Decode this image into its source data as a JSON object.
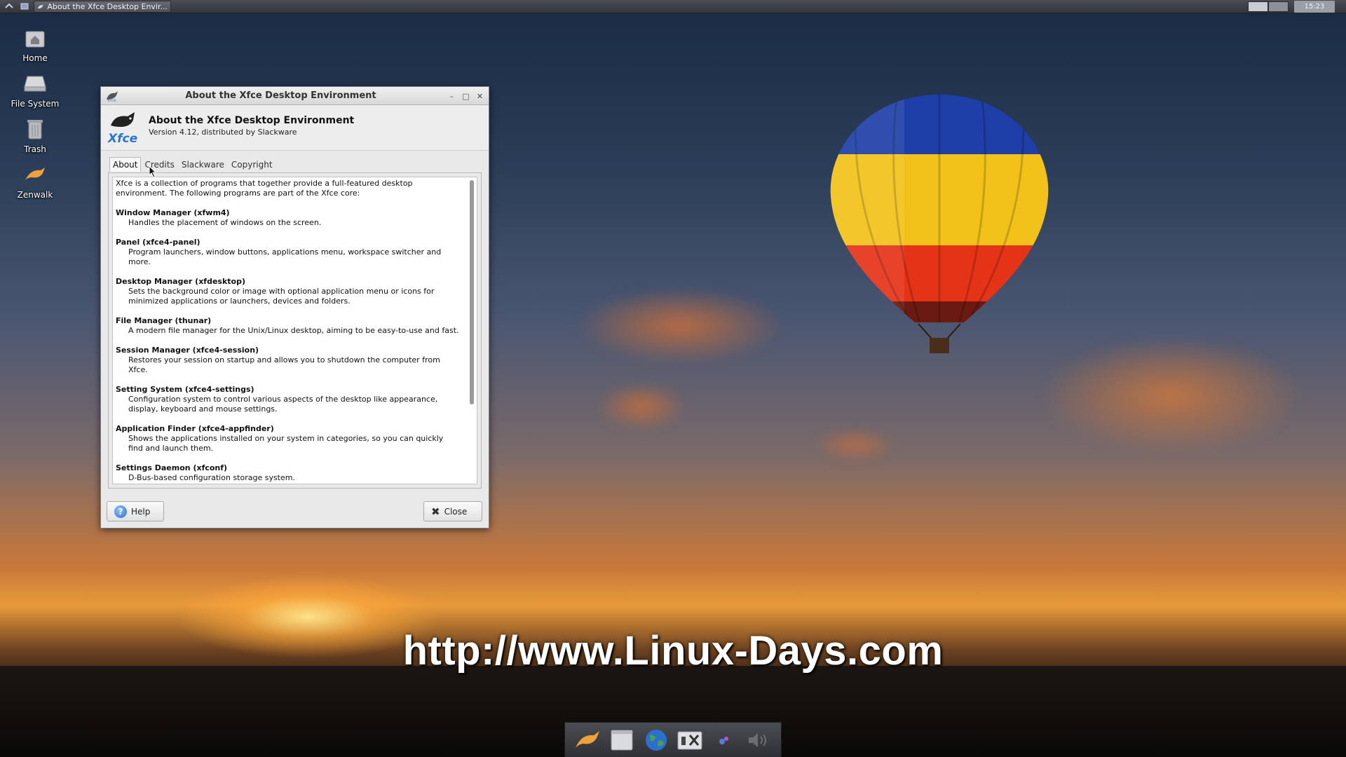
{
  "top_panel": {
    "menu_icon": "mouse-menu-icon",
    "show_desktop_icon": "window-list-icon",
    "task_title": "About the Xfce Desktop Envir...",
    "clock": "15:23"
  },
  "desktop_icons": [
    {
      "label": "Home",
      "icon": "home-folder-icon"
    },
    {
      "label": "File System",
      "icon": "drive-icon"
    },
    {
      "label": "Trash",
      "icon": "trash-icon"
    },
    {
      "label": "Zenwalk",
      "icon": "zenwalk-dolphin-icon"
    }
  ],
  "window": {
    "title": "About the Xfce Desktop Environment",
    "header_title": "About the Xfce Desktop Environment",
    "header_sub": "Version 4.12, distributed by Slackware",
    "tabs": [
      "About",
      "Credits",
      "Slackware",
      "Copyright"
    ],
    "intro": "Xfce is a collection of programs that together provide a full-featured desktop environment. The following programs are part of the Xfce core:",
    "components": [
      {
        "name": "Window Manager (xfwm4)",
        "desc": "Handles the placement of windows on the screen."
      },
      {
        "name": "Panel (xfce4-panel)",
        "desc": "Program launchers, window buttons, applications menu, workspace switcher and more."
      },
      {
        "name": "Desktop Manager (xfdesktop)",
        "desc": "Sets the background color or image with optional application menu or icons for minimized applications or launchers, devices and folders."
      },
      {
        "name": "File Manager  (thunar)",
        "desc": "A modern file manager for the Unix/Linux desktop, aiming to be easy-to-use and fast."
      },
      {
        "name": "Session Manager (xfce4-session)",
        "desc": "Restores your session on startup and allows you to shutdown the computer from Xfce."
      },
      {
        "name": "Setting System (xfce4-settings)",
        "desc": "Configuration system to control various aspects of the desktop like appearance, display, keyboard and mouse settings."
      },
      {
        "name": "Application Finder (xfce4-appfinder)",
        "desc": "Shows the applications installed on your system in categories, so you can quickly find and launch them."
      },
      {
        "name": "Settings Daemon (xfconf)",
        "desc": "D-Bus-based configuration storage system."
      }
    ],
    "help_label": "Help",
    "close_label": "Close"
  },
  "watermark": "http://www.Linux-Days.com",
  "dock_items": [
    "zenwalk-dolphin-icon",
    "file-manager-icon",
    "web-browser-icon",
    "settings-manager-icon",
    "network-icon",
    "volume-icon"
  ]
}
